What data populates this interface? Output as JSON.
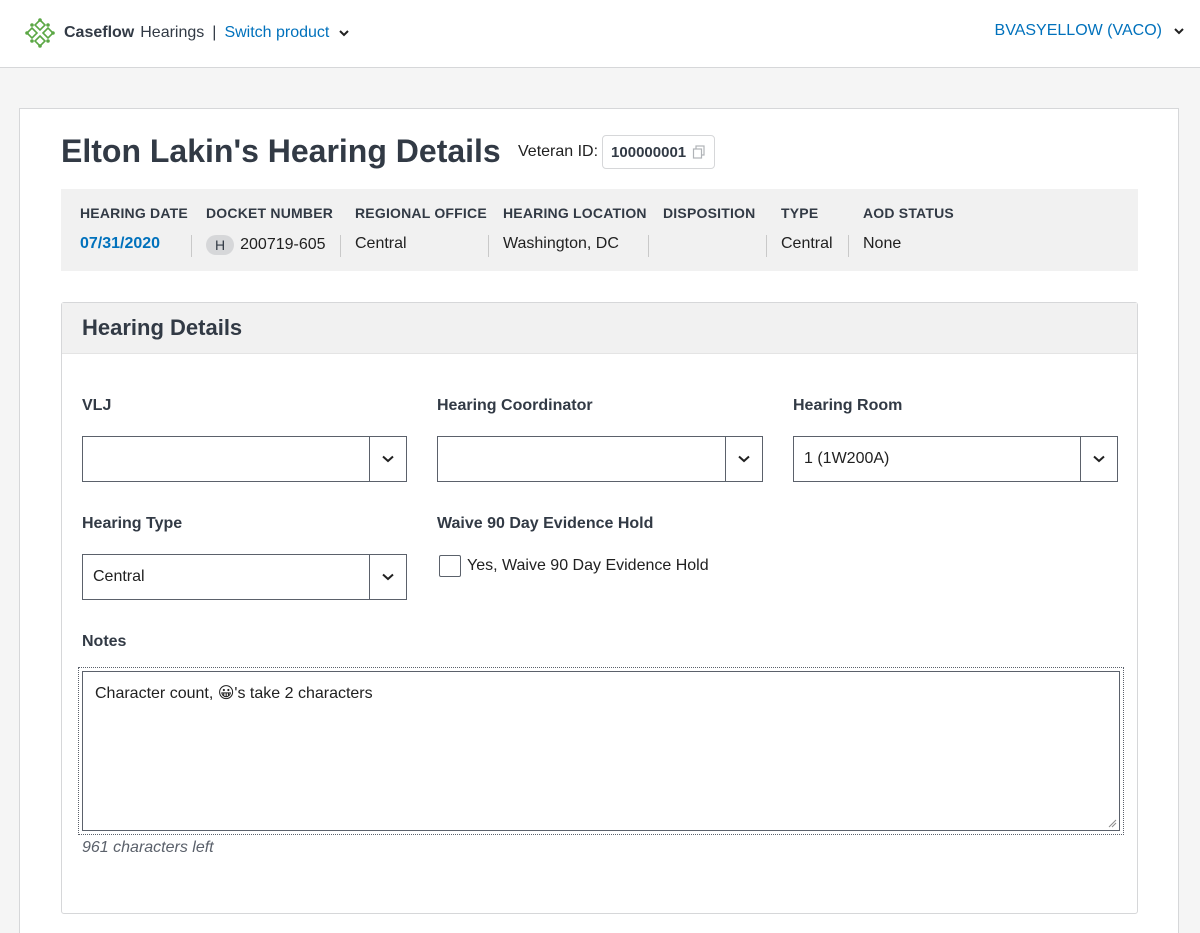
{
  "nav": {
    "brand": "Caseflow",
    "app": "Hearings",
    "separator": "|",
    "switch_product": "Switch product",
    "user": "BVASYELLOW (VACO)"
  },
  "page": {
    "title": "Elton Lakin's Hearing Details",
    "veteran_id_label": "Veteran ID:",
    "veteran_id": "100000001"
  },
  "summary": {
    "columns": [
      {
        "header": "HEARING DATE",
        "value": "07/31/2020"
      },
      {
        "header": "DOCKET NUMBER",
        "badge": "H",
        "value": "200719-605"
      },
      {
        "header": "REGIONAL OFFICE",
        "value": "Central"
      },
      {
        "header": "HEARING LOCATION",
        "value": "Washington, DC"
      },
      {
        "header": "DISPOSITION",
        "value": ""
      },
      {
        "header": "TYPE",
        "value": "Central"
      },
      {
        "header": "AOD STATUS",
        "value": "None"
      }
    ]
  },
  "details": {
    "title": "Hearing Details",
    "vlj": {
      "label": "VLJ",
      "value": ""
    },
    "coordinator": {
      "label": "Hearing Coordinator",
      "value": ""
    },
    "room": {
      "label": "Hearing Room",
      "value": "1 (1W200A)"
    },
    "hearing_type": {
      "label": "Hearing Type",
      "value": "Central"
    },
    "waive": {
      "label": "Waive 90 Day Evidence Hold",
      "checkbox_label": "Yes, Waive 90 Day Evidence Hold",
      "checked": false
    },
    "notes": {
      "label": "Notes",
      "value": "Character count, 😀's take 2 characters",
      "chars_left": "961 characters left"
    }
  },
  "colors": {
    "link": "#0071bc",
    "brand_green": "#5ba745",
    "text": "#212121",
    "border": "#5b616b",
    "panel_bg": "#f1f1f1"
  },
  "icons": [
    "caseflow-logo-icon",
    "chevron-down-icon",
    "copy-icon"
  ]
}
